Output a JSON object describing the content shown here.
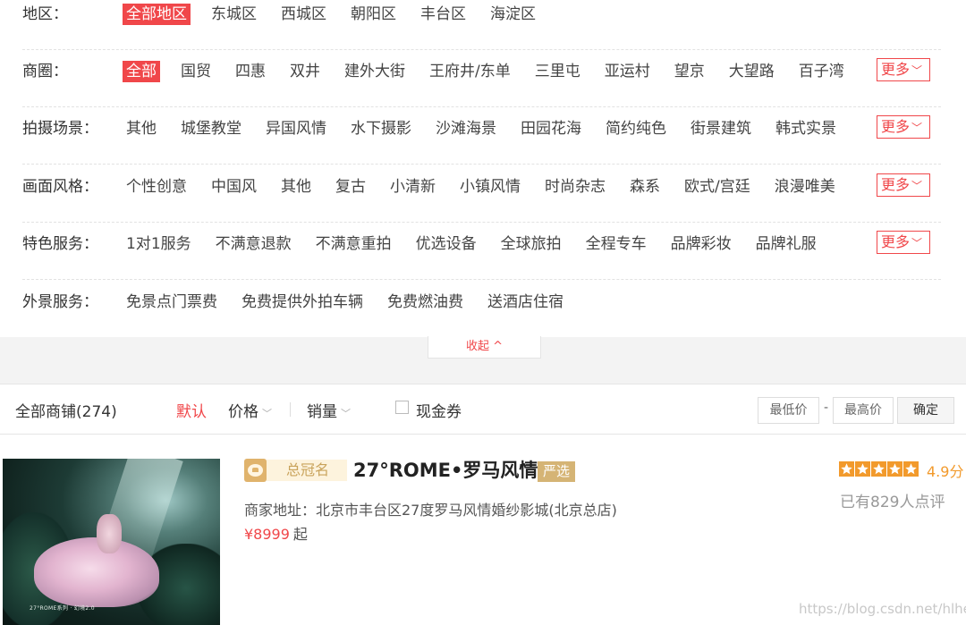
{
  "filters": [
    {
      "label": "地区：",
      "options": [
        "全部地区",
        "东城区",
        "西城区",
        "朝阳区",
        "丰台区",
        "海淀区"
      ],
      "selected": 0,
      "more": null
    },
    {
      "label": "商圈：",
      "options": [
        "全部",
        "国贸",
        "四惠",
        "双井",
        "建外大街",
        "王府井/东单",
        "三里屯",
        "亚运村",
        "望京",
        "大望路",
        "百子湾"
      ],
      "selected": 0,
      "more": "更多"
    },
    {
      "label": "拍摄场景：",
      "options": [
        "其他",
        "城堡教堂",
        "异国风情",
        "水下摄影",
        "沙滩海景",
        "田园花海",
        "简约纯色",
        "街景建筑",
        "韩式实景"
      ],
      "selected": -1,
      "more": "更多"
    },
    {
      "label": "画面风格：",
      "options": [
        "个性创意",
        "中国风",
        "其他",
        "复古",
        "小清新",
        "小镇风情",
        "时尚杂志",
        "森系",
        "欧式/宫廷",
        "浪漫唯美"
      ],
      "selected": -1,
      "more": "更多"
    },
    {
      "label": "特色服务：",
      "options": [
        "1对1服务",
        "不满意退款",
        "不满意重拍",
        "优选设备",
        "全球旅拍",
        "全程专车",
        "品牌彩妆",
        "品牌礼服"
      ],
      "selected": -1,
      "more": "更多"
    },
    {
      "label": "外景服务：",
      "options": [
        "免景点门票费",
        "免费提供外拍车辆",
        "免费燃油费",
        "送酒店住宿"
      ],
      "selected": -1,
      "more": null
    }
  ],
  "collapse_label": "收起 ^",
  "more_chevron": "﹀",
  "sortbar": {
    "all_shops": "全部商铺(274)",
    "default": "默认",
    "price": "价格",
    "sales": "销量",
    "chevron": "﹀",
    "coupon": "现金券",
    "min_price": "最低价",
    "dash": "-",
    "max_price": "最高价",
    "confirm": "确定"
  },
  "shop": {
    "rank": "总冠名",
    "name": "27°ROME•罗马风情",
    "badge": "严选",
    "address": "商家地址：北京市丰台区27度罗马风情婚纱影城(北京总店)",
    "price": "¥8999",
    "price_suffix": "起",
    "rating_stars": 5,
    "rating": "4.9分",
    "reviews": "已有829人点评",
    "image_caption": "27°ROME系列 · 幻境2.0",
    "star_color": "#f29a2c",
    "accent_color": "#f0474a"
  },
  "watermark": "https://blog.csdn.net/hlhell"
}
